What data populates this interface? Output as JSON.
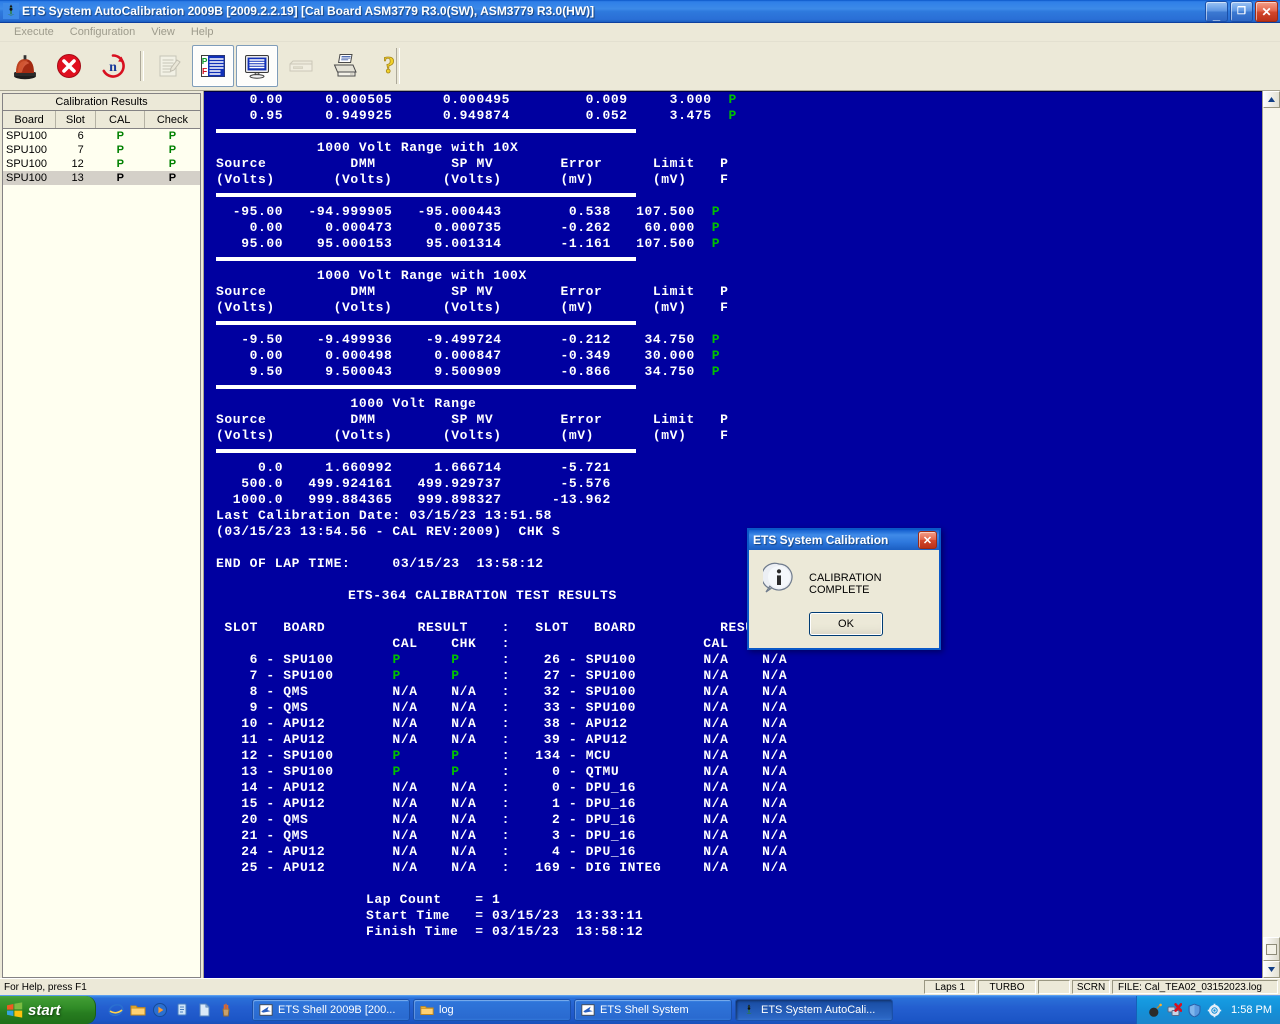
{
  "window": {
    "title": "ETS System AutoCalibration 2009B [2009.2.2.19]  [Cal Board ASM3779 R3.0(SW), ASM3779 R3.0(HW)]",
    "app_icon": "ets-app-icon",
    "minimize_label": "_",
    "restore_label": "❐",
    "close_label": "✕"
  },
  "menubar": {
    "items": [
      {
        "label": "Execute"
      },
      {
        "label": "Configuration"
      },
      {
        "label": "View"
      },
      {
        "label": "Help"
      }
    ]
  },
  "toolbar": {
    "buttons": [
      {
        "name": "alarm-beacon-icon",
        "title": "Alarm"
      },
      {
        "name": "stop-icon",
        "title": "Stop"
      },
      {
        "name": "loop-n-icon",
        "title": "Loop N Times"
      },
      {
        "name": "edit-log-icon",
        "title": "Edit Log"
      },
      {
        "name": "pass-fail-report-icon",
        "title": "Pass/Fail Report"
      },
      {
        "name": "display-monitor-icon",
        "title": "Display"
      },
      {
        "name": "disk-drive-icon",
        "title": "Drive"
      },
      {
        "name": "printer-icon",
        "title": "Print"
      },
      {
        "name": "help-question-icon",
        "title": "Help"
      }
    ]
  },
  "results_panel": {
    "title": "Calibration Results",
    "columns": [
      "Board",
      "Slot",
      "CAL",
      "Check"
    ],
    "rows": [
      {
        "board": "SPU100",
        "slot": "6",
        "cal": "P",
        "check": "P",
        "selected": false
      },
      {
        "board": "SPU100",
        "slot": "7",
        "cal": "P",
        "check": "P",
        "selected": false
      },
      {
        "board": "SPU100",
        "slot": "12",
        "cal": "P",
        "check": "P",
        "selected": false
      },
      {
        "board": "SPU100",
        "slot": "13",
        "cal": "P",
        "check": "P",
        "selected": true
      }
    ]
  },
  "terminal": {
    "blocks": [
      {
        "kind": "rows",
        "lines": [
          "    0.00     0.000505      0.000495         0.009     3.000  ~P",
          "    0.95     0.949925      0.949874         0.052     3.475  ~P"
        ]
      },
      {
        "kind": "rule"
      },
      {
        "kind": "header",
        "lines": [
          "            1000 Volt Range with 10X",
          "Source          DMM         SP MV        Error      Limit   P",
          "(Volts)       (Volts)      (Volts)       (mV)       (mV)    F"
        ]
      },
      {
        "kind": "rule"
      },
      {
        "kind": "rows",
        "lines": [
          "  -95.00   -94.999905   -95.000443        0.538   107.500  ~P",
          "    0.00     0.000473     0.000735       -0.262    60.000  ~P",
          "   95.00    95.000153    95.001314       -1.161   107.500  ~P"
        ]
      },
      {
        "kind": "rule"
      },
      {
        "kind": "header",
        "lines": [
          "            1000 Volt Range with 100X",
          "Source          DMM         SP MV        Error      Limit   P",
          "(Volts)       (Volts)      (Volts)       (mV)       (mV)    F"
        ]
      },
      {
        "kind": "rule"
      },
      {
        "kind": "rows",
        "lines": [
          "   -9.50    -9.499936    -9.499724       -0.212    34.750  ~P",
          "    0.00     0.000498     0.000847       -0.349    30.000  ~P",
          "    9.50     9.500043     9.500909       -0.866    34.750  ~P"
        ]
      },
      {
        "kind": "rule"
      },
      {
        "kind": "header",
        "lines": [
          "                1000 Volt Range",
          "Source          DMM         SP MV        Error      Limit   P",
          "(Volts)       (Volts)      (Volts)       (mV)       (mV)    F"
        ]
      },
      {
        "kind": "rule"
      },
      {
        "kind": "rows",
        "lines": [
          "     0.0     1.660992     1.666714       -5.721",
          "   500.0   499.924161   499.929737       -5.576",
          "  1000.0   999.884365   999.898327      -13.962",
          "Last Calibration Date: 03/15/23 13:51.58",
          "(03/15/23 13:54.56 - CAL REV:2009)  CHK S"
        ]
      },
      {
        "kind": "blank"
      },
      {
        "kind": "rows",
        "lines": [
          "END OF LAP TIME:     03/15/23  13:58:12"
        ]
      }
    ],
    "results_title": "ETS-364 CALIBRATION TEST RESULTS",
    "results_header": [
      " SLOT   BOARD           RESULT    :   SLOT   BOARD          RESULT",
      "                     CAL    CHK   :                       CAL    CHK"
    ],
    "results_rows": [
      {
        "l_slot": "6",
        "l_board": "SPU100",
        "l_cal": "P",
        "l_chk": "P",
        "r_slot": "26",
        "r_board": "SPU100",
        "r_cal": "N/A",
        "r_chk": "N/A"
      },
      {
        "l_slot": "7",
        "l_board": "SPU100",
        "l_cal": "P",
        "l_chk": "P",
        "r_slot": "27",
        "r_board": "SPU100",
        "r_cal": "N/A",
        "r_chk": "N/A"
      },
      {
        "l_slot": "8",
        "l_board": "QMS",
        "l_cal": "N/A",
        "l_chk": "N/A",
        "r_slot": "32",
        "r_board": "SPU100",
        "r_cal": "N/A",
        "r_chk": "N/A"
      },
      {
        "l_slot": "9",
        "l_board": "QMS",
        "l_cal": "N/A",
        "l_chk": "N/A",
        "r_slot": "33",
        "r_board": "SPU100",
        "r_cal": "N/A",
        "r_chk": "N/A"
      },
      {
        "l_slot": "10",
        "l_board": "APU12",
        "l_cal": "N/A",
        "l_chk": "N/A",
        "r_slot": "38",
        "r_board": "APU12",
        "r_cal": "N/A",
        "r_chk": "N/A"
      },
      {
        "l_slot": "11",
        "l_board": "APU12",
        "l_cal": "N/A",
        "l_chk": "N/A",
        "r_slot": "39",
        "r_board": "APU12",
        "r_cal": "N/A",
        "r_chk": "N/A"
      },
      {
        "l_slot": "12",
        "l_board": "SPU100",
        "l_cal": "P",
        "l_chk": "P",
        "r_slot": "134",
        "r_board": "MCU",
        "r_cal": "N/A",
        "r_chk": "N/A"
      },
      {
        "l_slot": "13",
        "l_board": "SPU100",
        "l_cal": "P",
        "l_chk": "P",
        "r_slot": "0",
        "r_board": "QTMU",
        "r_cal": "N/A",
        "r_chk": "N/A"
      },
      {
        "l_slot": "14",
        "l_board": "APU12",
        "l_cal": "N/A",
        "l_chk": "N/A",
        "r_slot": "0",
        "r_board": "DPU_16",
        "r_cal": "N/A",
        "r_chk": "N/A"
      },
      {
        "l_slot": "15",
        "l_board": "APU12",
        "l_cal": "N/A",
        "l_chk": "N/A",
        "r_slot": "1",
        "r_board": "DPU_16",
        "r_cal": "N/A",
        "r_chk": "N/A"
      },
      {
        "l_slot": "20",
        "l_board": "QMS",
        "l_cal": "N/A",
        "l_chk": "N/A",
        "r_slot": "2",
        "r_board": "DPU_16",
        "r_cal": "N/A",
        "r_chk": "N/A"
      },
      {
        "l_slot": "21",
        "l_board": "QMS",
        "l_cal": "N/A",
        "l_chk": "N/A",
        "r_slot": "3",
        "r_board": "DPU_16",
        "r_cal": "N/A",
        "r_chk": "N/A"
      },
      {
        "l_slot": "24",
        "l_board": "APU12",
        "l_cal": "N/A",
        "l_chk": "N/A",
        "r_slot": "4",
        "r_board": "DPU_16",
        "r_cal": "N/A",
        "r_chk": "N/A"
      },
      {
        "l_slot": "25",
        "l_board": "APU12",
        "l_cal": "N/A",
        "l_chk": "N/A",
        "r_slot": "169",
        "r_board": "DIG INTEG",
        "r_cal": "N/A",
        "r_chk": "N/A"
      }
    ],
    "summary": [
      "Lap Count    = 1",
      "Start Time   = 03/15/23  13:33:11",
      "Finish Time  = 03/15/23  13:58:12"
    ]
  },
  "scrollbar": {
    "up_arrow": "▲",
    "down_arrow": "▼"
  },
  "dialog": {
    "title": "ETS System Calibration",
    "close_label": "✕",
    "icon": "info-icon",
    "message": "CALIBRATION COMPLETE",
    "ok_label": "OK"
  },
  "statusbar": {
    "hint": "For Help, press F1",
    "laps": "Laps 1",
    "turbo": "TURBO",
    "scrn": "SCRN",
    "file": "FILE: Cal_TEA02_03152023.log"
  },
  "taskbar": {
    "start_label": "start",
    "quick_launch": [
      {
        "name": "internet-explorer-icon"
      },
      {
        "name": "folder-icon"
      },
      {
        "name": "media-player-icon"
      },
      {
        "name": "show-desktop-icon"
      },
      {
        "name": "document-icon"
      },
      {
        "name": "pencil-cup-icon"
      }
    ],
    "tasks": [
      {
        "label": "ETS Shell 2009B [200...",
        "icon": "ets-shell-icon",
        "active": false
      },
      {
        "label": "log",
        "icon": "folder-icon",
        "active": false
      },
      {
        "label": "ETS Shell System",
        "icon": "ets-shell-icon",
        "active": false
      },
      {
        "label": "ETS System AutoCali...",
        "icon": "ets-app-icon",
        "active": true
      }
    ],
    "tray": [
      {
        "name": "bomb-icon"
      },
      {
        "name": "network-error-icon"
      },
      {
        "name": "shield-icon"
      },
      {
        "name": "settings-gear-icon"
      }
    ],
    "clock": "1:58 PM"
  },
  "colors": {
    "terminal_bg": "#0000a0",
    "terminal_fg": "#ffffff",
    "pass_green": "#00c000",
    "chrome": "#ece9d8",
    "title_blue": "#2f7fe8"
  }
}
